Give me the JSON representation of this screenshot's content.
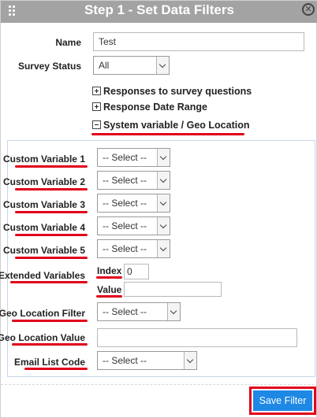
{
  "dialog": {
    "title": "Step 1 - Set Data Filters",
    "close_glyph": "⊗"
  },
  "form": {
    "name_label": "Name",
    "name_value": "Test",
    "survey_status_label": "Survey Status",
    "survey_status_value": "All"
  },
  "sections": {
    "responses": "Responses to survey questions",
    "date_range": "Response Date Range",
    "system_geo": "System variable / Geo Location"
  },
  "system": {
    "select_placeholder": "-- Select --",
    "custom_variables": [
      {
        "label": "Custom Variable 1",
        "value": "-- Select --"
      },
      {
        "label": "Custom Variable 2",
        "value": "-- Select --"
      },
      {
        "label": "Custom Variable 3",
        "value": "-- Select --"
      },
      {
        "label": "Custom Variable 4",
        "value": "-- Select --"
      },
      {
        "label": "Custom Variable 5",
        "value": "-- Select --"
      }
    ],
    "extended_label": "Extended Variables",
    "index_label": "Index :",
    "index_value": "0",
    "value_label": "Value :",
    "value_value": "",
    "geo_filter_label": "Geo Location Filter",
    "geo_filter_value": "-- Select --",
    "geo_value_label": "Geo Location Value",
    "geo_value_value": "",
    "email_label": "Email List Code",
    "email_value": "-- Select --"
  },
  "footer": {
    "save_label": "Save Filter"
  },
  "colors": {
    "titlebar": "#a3a3a3",
    "highlight_red": "#e0001b",
    "save_blue": "#1e88e5"
  }
}
